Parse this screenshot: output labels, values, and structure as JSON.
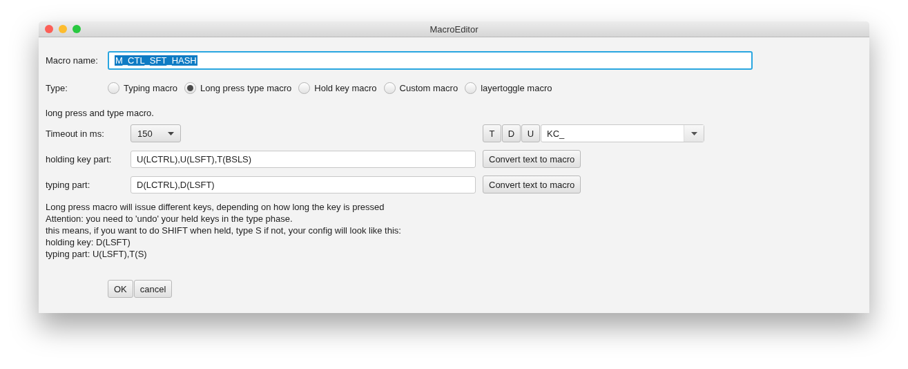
{
  "window": {
    "title": "MacroEditor"
  },
  "macro_name": {
    "label": "Macro name:",
    "value": "M_CTL_SFT_HASH",
    "text_selected": true
  },
  "type": {
    "label": "Type:",
    "options": [
      {
        "label": "Typing macro",
        "selected": false
      },
      {
        "label": "Long press type macro",
        "selected": true
      },
      {
        "label": "Hold key macro",
        "selected": false
      },
      {
        "label": "Custom macro",
        "selected": false
      },
      {
        "label": "layertoggle macro",
        "selected": false
      }
    ]
  },
  "description": "long press and type macro.",
  "timeout": {
    "label": "Timeout in ms:",
    "value": "150"
  },
  "key_buttons": [
    "T",
    "D",
    "U"
  ],
  "keycode": {
    "value": "KC_"
  },
  "holding": {
    "label": "holding key part:",
    "value": "U(LCTRL),U(LSFT),T(BSLS)",
    "button": "Convert text to macro"
  },
  "typing": {
    "label": "typing part:",
    "value": "D(LCTRL),D(LSFT)",
    "button": "Convert text to macro"
  },
  "notes": [
    "Long press macro will issue different keys, depending on how long the key is pressed",
    "Attention: you need to 'undo' your held keys in the type phase.",
    "this means, if you want to do SHIFT when held, type S if not, your config will look like this:",
    "holding key: D(LSFT)",
    "typing part: U(LSFT),T(S)"
  ],
  "buttons": [
    "OK",
    "cancel"
  ]
}
